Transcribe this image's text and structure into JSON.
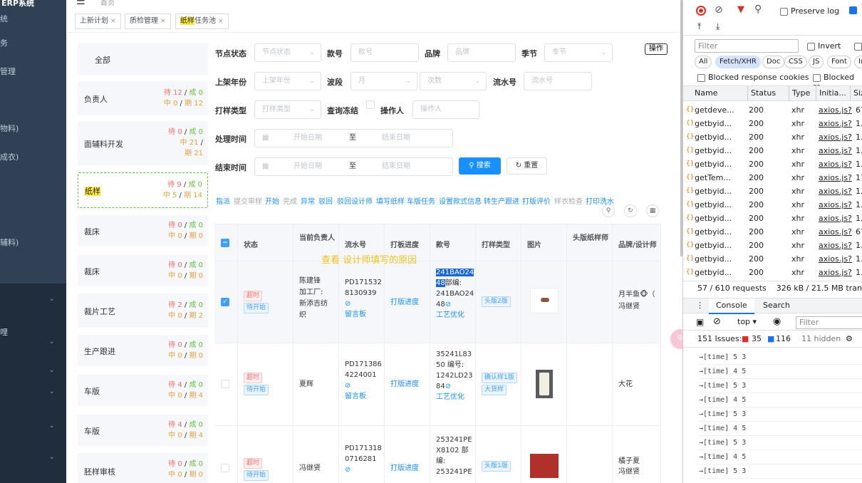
{
  "sidebar": {
    "title": "ERP系统",
    "items": [
      "统",
      "务",
      "管理",
      "物料)",
      "成衣)",
      "辅料)",
      "",
      "",
      "",
      "",
      "",
      ""
    ]
  },
  "topbar": {
    "breadcrumb": "首页"
  },
  "tabs": [
    {
      "label": "上新计划"
    },
    {
      "label": "质检管理"
    },
    {
      "label_hl": "纸样",
      "label": "任务池"
    }
  ],
  "left_cards": [
    {
      "name": "全部",
      "l1": "",
      "l2": ""
    },
    {
      "name": "负责人",
      "l1a": "待 12",
      "l1b": "成 0",
      "l2a": "中 0",
      "l2b": "期 12"
    },
    {
      "name": "面辅料开发",
      "l1a": "待 0",
      "l1b": "成 0",
      "l2a": "中 21",
      "l2b": "期 21"
    },
    {
      "name": "纸样",
      "l1a": "待 9",
      "l1b": "成 0",
      "l2a": "中 5",
      "l2b": "期 14"
    },
    {
      "name": "裁床",
      "l1a": "待 0",
      "l1b": "成 0",
      "l2a": "中 0",
      "l2b": "期 0"
    },
    {
      "name": "裁床",
      "l1a": "待 0",
      "l1b": "成 0",
      "l2a": "中 0",
      "l2b": "期 0"
    },
    {
      "name": "裁片工艺",
      "l1a": "待 2",
      "l1b": "成 0",
      "l2a": "中 0",
      "l2b": "期 2"
    },
    {
      "name": "生产跟进",
      "l1a": "待 0",
      "l1b": "成 0",
      "l2a": "中 0",
      "l2b": "期 0"
    },
    {
      "name": "车版",
      "l1a": "待 4",
      "l1b": "成 0",
      "l2a": "中 0",
      "l2b": "期 4"
    },
    {
      "name": "车版",
      "l1a": "待 4",
      "l1b": "成 0",
      "l2a": "中 0",
      "l2b": "期 4"
    },
    {
      "name": "胚样审核",
      "l1a": "待 0",
      "l1b": "成 0",
      "l2a": "中 0",
      "l2b": "期 0"
    }
  ],
  "filters": {
    "node_status_label": "节点状态",
    "node_status_ph": "节点状态",
    "style_label": "款号",
    "style_ph": "款号",
    "brand_label": "品牌",
    "brand_ph": "品牌",
    "season_label": "季节",
    "season_ph": "季节",
    "year_label": "上架年份",
    "year_ph": "上架年份",
    "band_label": "波段",
    "band_ph": "月",
    "band_ph2": "次数",
    "serial_label": "流水号",
    "serial_ph": "流水号",
    "sample_type_label": "打样类型",
    "sample_type_ph": "打样类型",
    "freeze_label": "查询冻结",
    "operator_label": "操作人",
    "operator_ph": "操作人",
    "process_time_label": "处理时间",
    "end_time_label": "结束时间",
    "start_ph": "开始日期",
    "to": "至",
    "end_ph": "结束日期",
    "search_btn": "搜索",
    "reset_btn": "重置",
    "ops_btn": "操作"
  },
  "actions": [
    "指派",
    "提交审样",
    "开始",
    "完成",
    "异常",
    "驳回",
    "驳回设计师",
    "填写纸样",
    "车版任务",
    "设置款式信息",
    "转生产跟进",
    "打版评价",
    "样衣检查",
    "打印洗水"
  ],
  "overlay_text": "查看 设计师填写的原因",
  "table": {
    "headers": [
      "状态",
      "当前负责人",
      "流水号",
      "打板进度",
      "款号",
      "打样类型",
      "图片",
      "头版纸样师",
      "品牌/设计师"
    ],
    "rows": [
      {
        "tags": [
          "超时",
          "待开始"
        ],
        "owner": "陈建锋\n加工厂:\n新添吉纺\n织",
        "serial": "PD171532\n8130939",
        "msg": "留言板",
        "progress": "打版进度",
        "style_hl": "241BAO24\n48",
        "style_rest": "部编:\n241BAO24\n48",
        "craft": "工艺优化",
        "sample": [
          "头版2版"
        ],
        "brand": "月半鱼🐵（\n冯继贤"
      },
      {
        "tags": [
          "超时",
          "待开始"
        ],
        "owner": "夏辉",
        "serial": "PD171386\n4224001",
        "msg": "留言板",
        "progress": "打版进度",
        "style_hl": "",
        "style_rest": "35241L83\n50 编号:\n1242LD23\n84",
        "craft": "工艺优化",
        "sample": [
          "确认样1版",
          "大货样"
        ],
        "brand": "大花"
      },
      {
        "tags": [
          "超时",
          "待开始"
        ],
        "owner": "冯继贤",
        "serial": "PD171318\n0716281",
        "msg": "",
        "progress": "打版进度",
        "style_hl": "",
        "style_rest": "253241PE\nX8102 部\n编:\n253241PE",
        "craft": "",
        "sample": [
          "头版1版"
        ],
        "brand": "橘子夏\n冯继贤"
      }
    ]
  },
  "devtools": {
    "preserve_log": "Preserve log",
    "filter_ph": "Filter",
    "invert": "Invert",
    "chips": [
      "All",
      "Fetch/XHR",
      "Doc",
      "CSS",
      "JS",
      "Font",
      "Im"
    ],
    "blocked_cookies": "Blocked response cookies",
    "blocked_req": "Blocked re",
    "cols": [
      "Name",
      "Status",
      "Type",
      "Initia...",
      "Siz"
    ],
    "requests": [
      {
        "name": "getdeve...",
        "status": "200",
        "type": "xhr",
        "init": "axios.js?",
        "size": "67"
      },
      {
        "name": "getbyid...",
        "status": "200",
        "type": "xhr",
        "init": "axios.js?",
        "size": "1.3"
      },
      {
        "name": "getbyid...",
        "status": "200",
        "type": "xhr",
        "init": "axios.js?",
        "size": "1.3"
      },
      {
        "name": "getbyid...",
        "status": "200",
        "type": "xhr",
        "init": "axios.js?",
        "size": "1.3"
      },
      {
        "name": "getbyid...",
        "status": "200",
        "type": "xhr",
        "init": "axios.js?",
        "size": "1.3"
      },
      {
        "name": "getTem...",
        "status": "200",
        "type": "xhr",
        "init": "axios.js?",
        "size": "17."
      },
      {
        "name": "getbyid...",
        "status": "200",
        "type": "xhr",
        "init": "axios.js?",
        "size": "1.3"
      },
      {
        "name": "getbyid...",
        "status": "200",
        "type": "xhr",
        "init": "axios.js?",
        "size": "1.0"
      },
      {
        "name": "getbyid...",
        "status": "200",
        "type": "xhr",
        "init": "axios.js?",
        "size": "1.0"
      },
      {
        "name": "getbyid...",
        "status": "200",
        "type": "xhr",
        "init": "axios.js?",
        "size": "67"
      },
      {
        "name": "getbyid...",
        "status": "200",
        "type": "xhr",
        "init": "axios.js?",
        "size": "1.3"
      },
      {
        "name": "getbyid...",
        "status": "200",
        "type": "xhr",
        "init": "axios.js?",
        "size": "1.0"
      },
      {
        "name": "getbyid...",
        "status": "200",
        "type": "xhr",
        "init": "axios.js?",
        "size": "1.0"
      }
    ],
    "summary": "57 / 610 requests",
    "transfer": "326 kB / 21.5 MB transfe",
    "console_tab": "Console",
    "search_tab": "Search",
    "context": "top",
    "con_filter_ph": "Filter",
    "issues": "151 Issues:",
    "err_count": "35",
    "info_count": "116",
    "hidden": "11 hidden",
    "logs": [
      "[time] 5 3",
      "[time] 4 5",
      "[time] 5 3",
      "[time] 4 5",
      "[time] 5 3",
      "[time] 4 5",
      "[time] 5 3",
      "[time] 4 5",
      "[time] 5 3"
    ]
  }
}
